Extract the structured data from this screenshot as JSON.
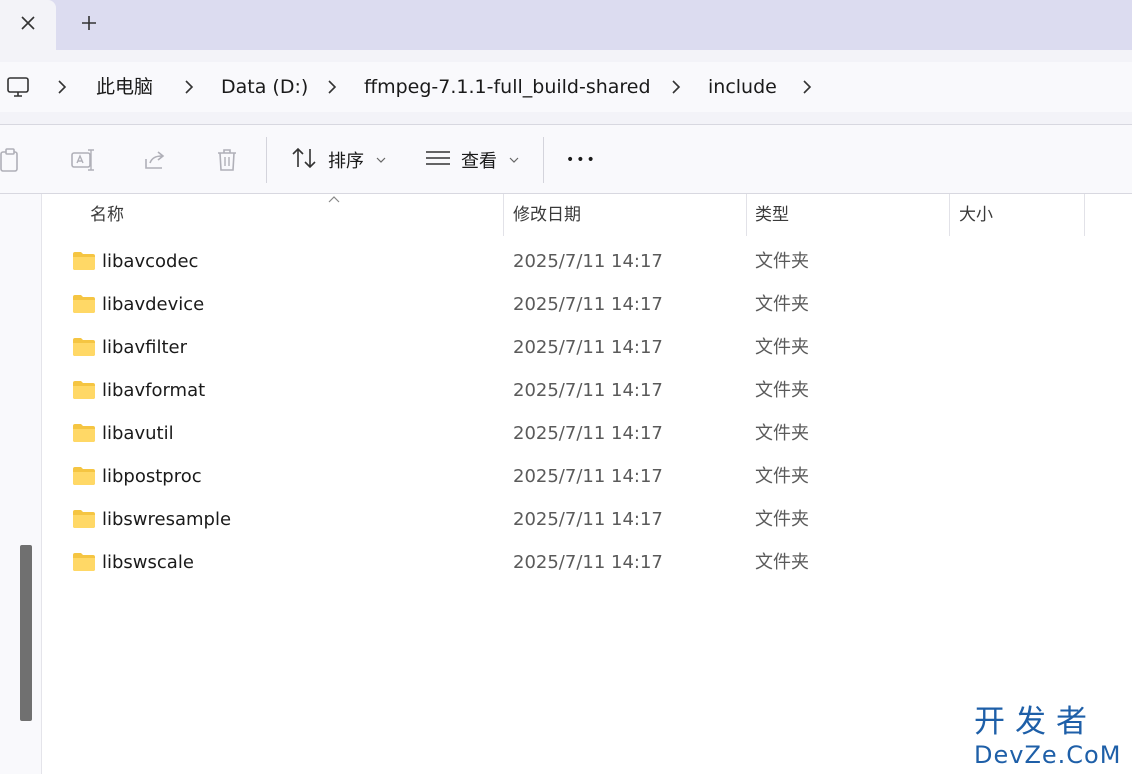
{
  "tabs": {
    "close_icon": "close-icon",
    "new_tab_icon": "plus-icon"
  },
  "breadcrumb": {
    "root_icon": "monitor-icon",
    "items": [
      "此电脑",
      "Data (D:)",
      "ffmpeg-7.1.1-full_build-shared",
      "include"
    ]
  },
  "commandbar": {
    "sort_label": "排序",
    "view_label": "查看",
    "more_label": "•••"
  },
  "columns": {
    "name": "名称",
    "date": "修改日期",
    "type": "类型",
    "size": "大小"
  },
  "rows": [
    {
      "name": "libavcodec",
      "date": "2025/7/11 14:17",
      "type": "文件夹"
    },
    {
      "name": "libavdevice",
      "date": "2025/7/11 14:17",
      "type": "文件夹"
    },
    {
      "name": "libavfilter",
      "date": "2025/7/11 14:17",
      "type": "文件夹"
    },
    {
      "name": "libavformat",
      "date": "2025/7/11 14:17",
      "type": "文件夹"
    },
    {
      "name": "libavutil",
      "date": "2025/7/11 14:17",
      "type": "文件夹"
    },
    {
      "name": "libpostproc",
      "date": "2025/7/11 14:17",
      "type": "文件夹"
    },
    {
      "name": "libswresample",
      "date": "2025/7/11 14:17",
      "type": "文件夹"
    },
    {
      "name": "libswscale",
      "date": "2025/7/11 14:17",
      "type": "文件夹"
    }
  ],
  "watermark": {
    "top": "开发者",
    "bottom": "DevZe.CoM"
  },
  "colors": {
    "accent": "#1e5fa8",
    "folder": "#f5c542",
    "tabstrip": "#dcdcf0"
  }
}
